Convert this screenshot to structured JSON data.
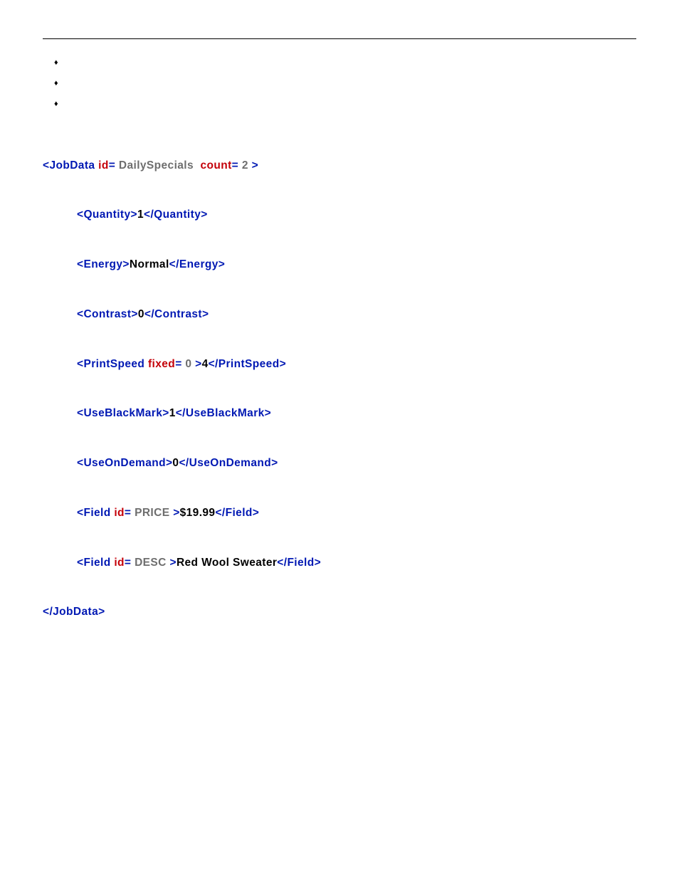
{
  "xml": {
    "jobdata": {
      "open_tag": "<JobData",
      "attr_id_name": "id",
      "eq": "=",
      "attr_id_val": "DailySpecials",
      "attr_count_name": "count",
      "attr_count_val": "2",
      "open_end": ">",
      "close": "</JobData>"
    },
    "quantity": {
      "open": "<Quantity>",
      "val": "1",
      "close": "</Quantity>"
    },
    "energy": {
      "open": "<Energy>",
      "val": "Normal",
      "close": "</Energy>"
    },
    "contrast": {
      "open": "<Contrast>",
      "val": "0",
      "close": "</Contrast>"
    },
    "printspeed": {
      "open_tag": "<PrintSpeed",
      "attr_name": "fixed",
      "attr_val": "0",
      "open_end": ">",
      "val": "4",
      "close": "</PrintSpeed>"
    },
    "useblackmark": {
      "open": "<UseBlackMark>",
      "val": "1",
      "close": "</UseBlackMark>"
    },
    "useondemand": {
      "open": "<UseOnDemand>",
      "val": "0",
      "close": "</UseOnDemand>"
    },
    "field_price": {
      "open_tag": "<Field",
      "attr_name": "id",
      "attr_val": "PRICE",
      "open_end": ">",
      "val": "$19.99",
      "close": "</Field>"
    },
    "field_desc": {
      "open_tag": "<Field",
      "attr_name": "id",
      "attr_val": "DESC",
      "open_end": ">",
      "val": "Red Wool Sweater",
      "close": "</Field>"
    }
  }
}
